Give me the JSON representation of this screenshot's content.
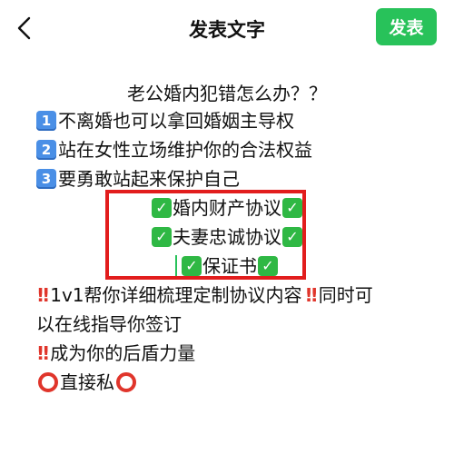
{
  "header": {
    "title": "发表文字",
    "publish_label": "发表",
    "back_icon": "chevron-left-icon",
    "accent_color": "#28c25a"
  },
  "post": {
    "title_line": "老公婚内犯错怎么办？？",
    "points": [
      {
        "num": "1",
        "text": "不离婚也可以拿回婚姻主导权"
      },
      {
        "num": "2",
        "text": "站在女性立场维护你的合法权益"
      },
      {
        "num": "3",
        "text": "要勇敢站起来保护自己"
      }
    ],
    "highlighted": [
      "婚内财产协议",
      "夫妻忠诚协议",
      "保证书"
    ],
    "service_line1": "1v1帮你详细梳理定制协议内容",
    "service_line1_tail": "同时可",
    "service_line2": "以在线指导你签订",
    "shield_line": "成为你的后盾力量",
    "contact_line": "直接私",
    "highlight_border_color": "#e21d1d"
  }
}
